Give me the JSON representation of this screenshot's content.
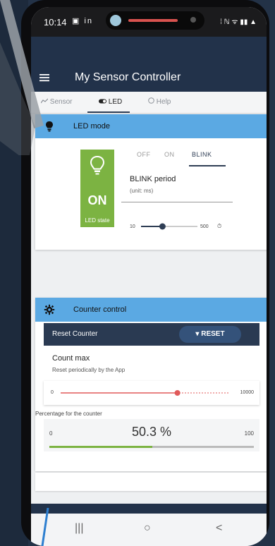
{
  "status_bar": {
    "time": "10:14",
    "left_icons": "▣ in",
    "right_icons": "⁞ ℕ ᯤ ▮▮ ▲"
  },
  "app": {
    "title": "My Sensor Controller",
    "menu_icon": "menu-icon"
  },
  "tabs": [
    {
      "label": "Sensor",
      "icon": "chart-icon"
    },
    {
      "label": "LED",
      "icon": "toggle-icon"
    },
    {
      "label": "Help",
      "icon": "help-icon"
    }
  ],
  "led_card": {
    "header": "LED mode",
    "header_icon": "bulb-icon",
    "led_status": "ON",
    "led_state_label": "LED state",
    "modes": [
      "OFF",
      "ON",
      "BLINK"
    ],
    "selected_mode": "BLINK",
    "blink_title": "BLINK period",
    "blink_unit": "(unit: ms)",
    "slider_min": "10",
    "slider_max": "500",
    "slider_value_fraction": 0.38,
    "timer_icon": "timer-icon"
  },
  "counter_card": {
    "header": "Counter control",
    "header_icon": "gear-icon",
    "reset_label": "Reset Counter",
    "reset_button": "▾ RESET",
    "count_max_title": "Count max",
    "count_max_sub": "Reset periodically by the App",
    "count_min": "0",
    "count_max": "10000",
    "count_value_fraction": 0.69,
    "percentage_label": "Percentage for the counter",
    "pct_min": "0",
    "pct_max": "100",
    "pct_value": "50.3 %",
    "pct_fraction": 0.503
  },
  "navbar": {
    "recents": "|||",
    "home": "○",
    "back": "<"
  },
  "colors": {
    "header_blue": "#5ba9e3",
    "led_green": "#7cb342",
    "app_bar": "#22324a",
    "slider_red": "#e05a5a"
  }
}
